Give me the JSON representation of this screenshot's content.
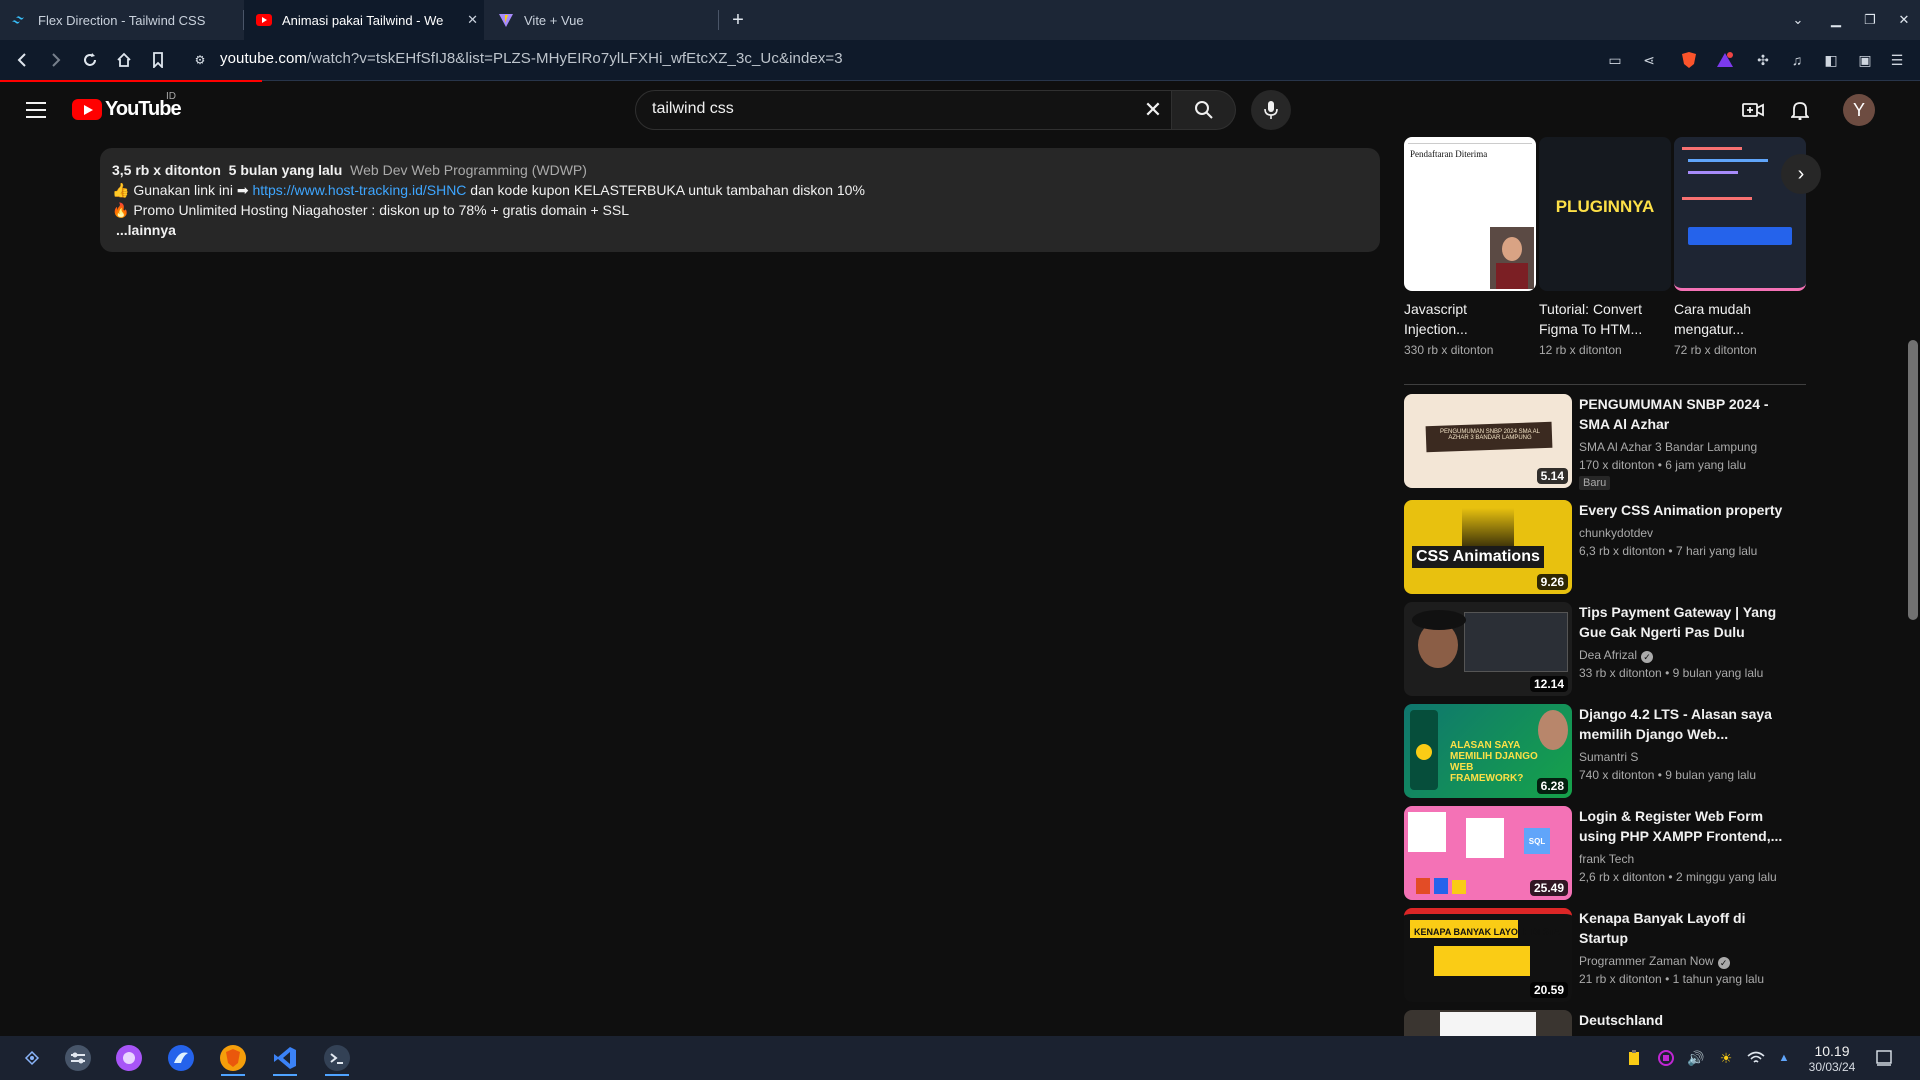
{
  "browser": {
    "tabs": [
      {
        "title": "Flex Direction - Tailwind CSS",
        "icon": "tailwind-icon"
      },
      {
        "title": "Animasi pakai Tailwind - We",
        "icon": "youtube-icon",
        "active": true
      },
      {
        "title": "Vite + Vue",
        "icon": "vite-icon"
      }
    ],
    "new_tab": "+",
    "url_host": "youtube.com",
    "url_path": "/watch?v=tskEHfSfIJ8&list=PLZS-MHyEIRo7ylLFXHi_wfEtcXZ_3c_Uc&index=3"
  },
  "youtube": {
    "logo_text": "YouTube",
    "country_code": "ID",
    "search_value": "tailwind css",
    "avatar_letter": "Y"
  },
  "description": {
    "views": "3,5 rb x ditonton",
    "age": "5 bulan yang lalu",
    "tags": "Web Dev Web Programming (WDWP)",
    "line1_prefix": "👍 Gunakan link ini ➡ ",
    "line1_link": "https://www.host-tracking.id/SHNC",
    "line1_suffix": " dan kode kupon KELASTERBUKA untuk tambahan diskon 10%",
    "line2": "🔥 Promo Unlimited Hosting Niagahoster : diskon up to 78% + gratis domain + SSL",
    "more": "...lainnya"
  },
  "playlist_strip": [
    {
      "title_1": "Javascript",
      "title_2": "Injection...",
      "views": "330 rb x ditonton",
      "thumb_text": "Pendaftaran Diterima"
    },
    {
      "title_1": "Tutorial: Convert",
      "title_2": "Figma To HTM...",
      "views": "12 rb x ditonton",
      "thumb_text": "PLUGINNYA"
    },
    {
      "title_1": "Cara mudah",
      "title_2": "mengatur...",
      "views": "72 rb x ditonton",
      "thumb_text": ""
    }
  ],
  "related": [
    {
      "title": "PENGUMUMAN SNBP 2024 - SMA Al Azhar",
      "channel": "SMA Al Azhar 3 Bandar Lampung",
      "views": "170 x ditonton",
      "age": "6 jam yang lalu",
      "duration": "5.14",
      "badge": "Baru",
      "verified": false,
      "thumb_text": "PENGUMUMAN SNBP 2024 SMA AL AZHAR 3 BANDAR LAMPUNG"
    },
    {
      "title": "Every CSS Animation property",
      "channel": "chunkydotdev",
      "views": "6,3 rb x ditonton",
      "age": "7 hari yang lalu",
      "duration": "9.26",
      "badge": "",
      "verified": false,
      "thumb_text": "CSS Animations"
    },
    {
      "title": "Tips Payment Gateway | Yang Gue Gak Ngerti Pas Dulu Belaj...",
      "channel": "Dea Afrizal",
      "views": "33 rb x ditonton",
      "age": "9 bulan yang lalu",
      "duration": "12.14",
      "badge": "",
      "verified": true,
      "thumb_text": ""
    },
    {
      "title": "Django 4.2 LTS - Alasan saya memilih Django Web...",
      "channel": "Sumantri S",
      "views": "740 x ditonton",
      "age": "9 bulan yang lalu",
      "duration": "6.28",
      "badge": "",
      "verified": false,
      "thumb_text": "ALASAN SAYA MEMILIH DJANGO WEB FRAMEWORK?"
    },
    {
      "title": "Login & Register Web Form using PHP XAMPP Frontend,...",
      "channel": "frank Tech",
      "views": "2,6 rb x ditonton",
      "age": "2 minggu yang lalu",
      "duration": "25.49",
      "badge": "",
      "verified": false,
      "thumb_text": "SQL"
    },
    {
      "title": "Kenapa Banyak Layoff di Startup",
      "channel": "Programmer Zaman Now",
      "views": "21 rb x ditonton",
      "age": "1 tahun yang lalu",
      "duration": "20.59",
      "badge": "",
      "verified": true,
      "thumb_text": "KENAPA BANYAK LAYOFF DI STA"
    },
    {
      "title": "Deutschland",
      "channel": "",
      "views": "",
      "age": "",
      "duration": "",
      "badge": "",
      "verified": false,
      "thumb_text": ""
    }
  ],
  "taskbar": {
    "time": "10.19",
    "date": "30/03/24"
  },
  "colors": {
    "yt_red": "#ff0000",
    "link_blue": "#3ea6ff",
    "bg": "#0f0f0f",
    "browser_bar": "#1c2636"
  }
}
